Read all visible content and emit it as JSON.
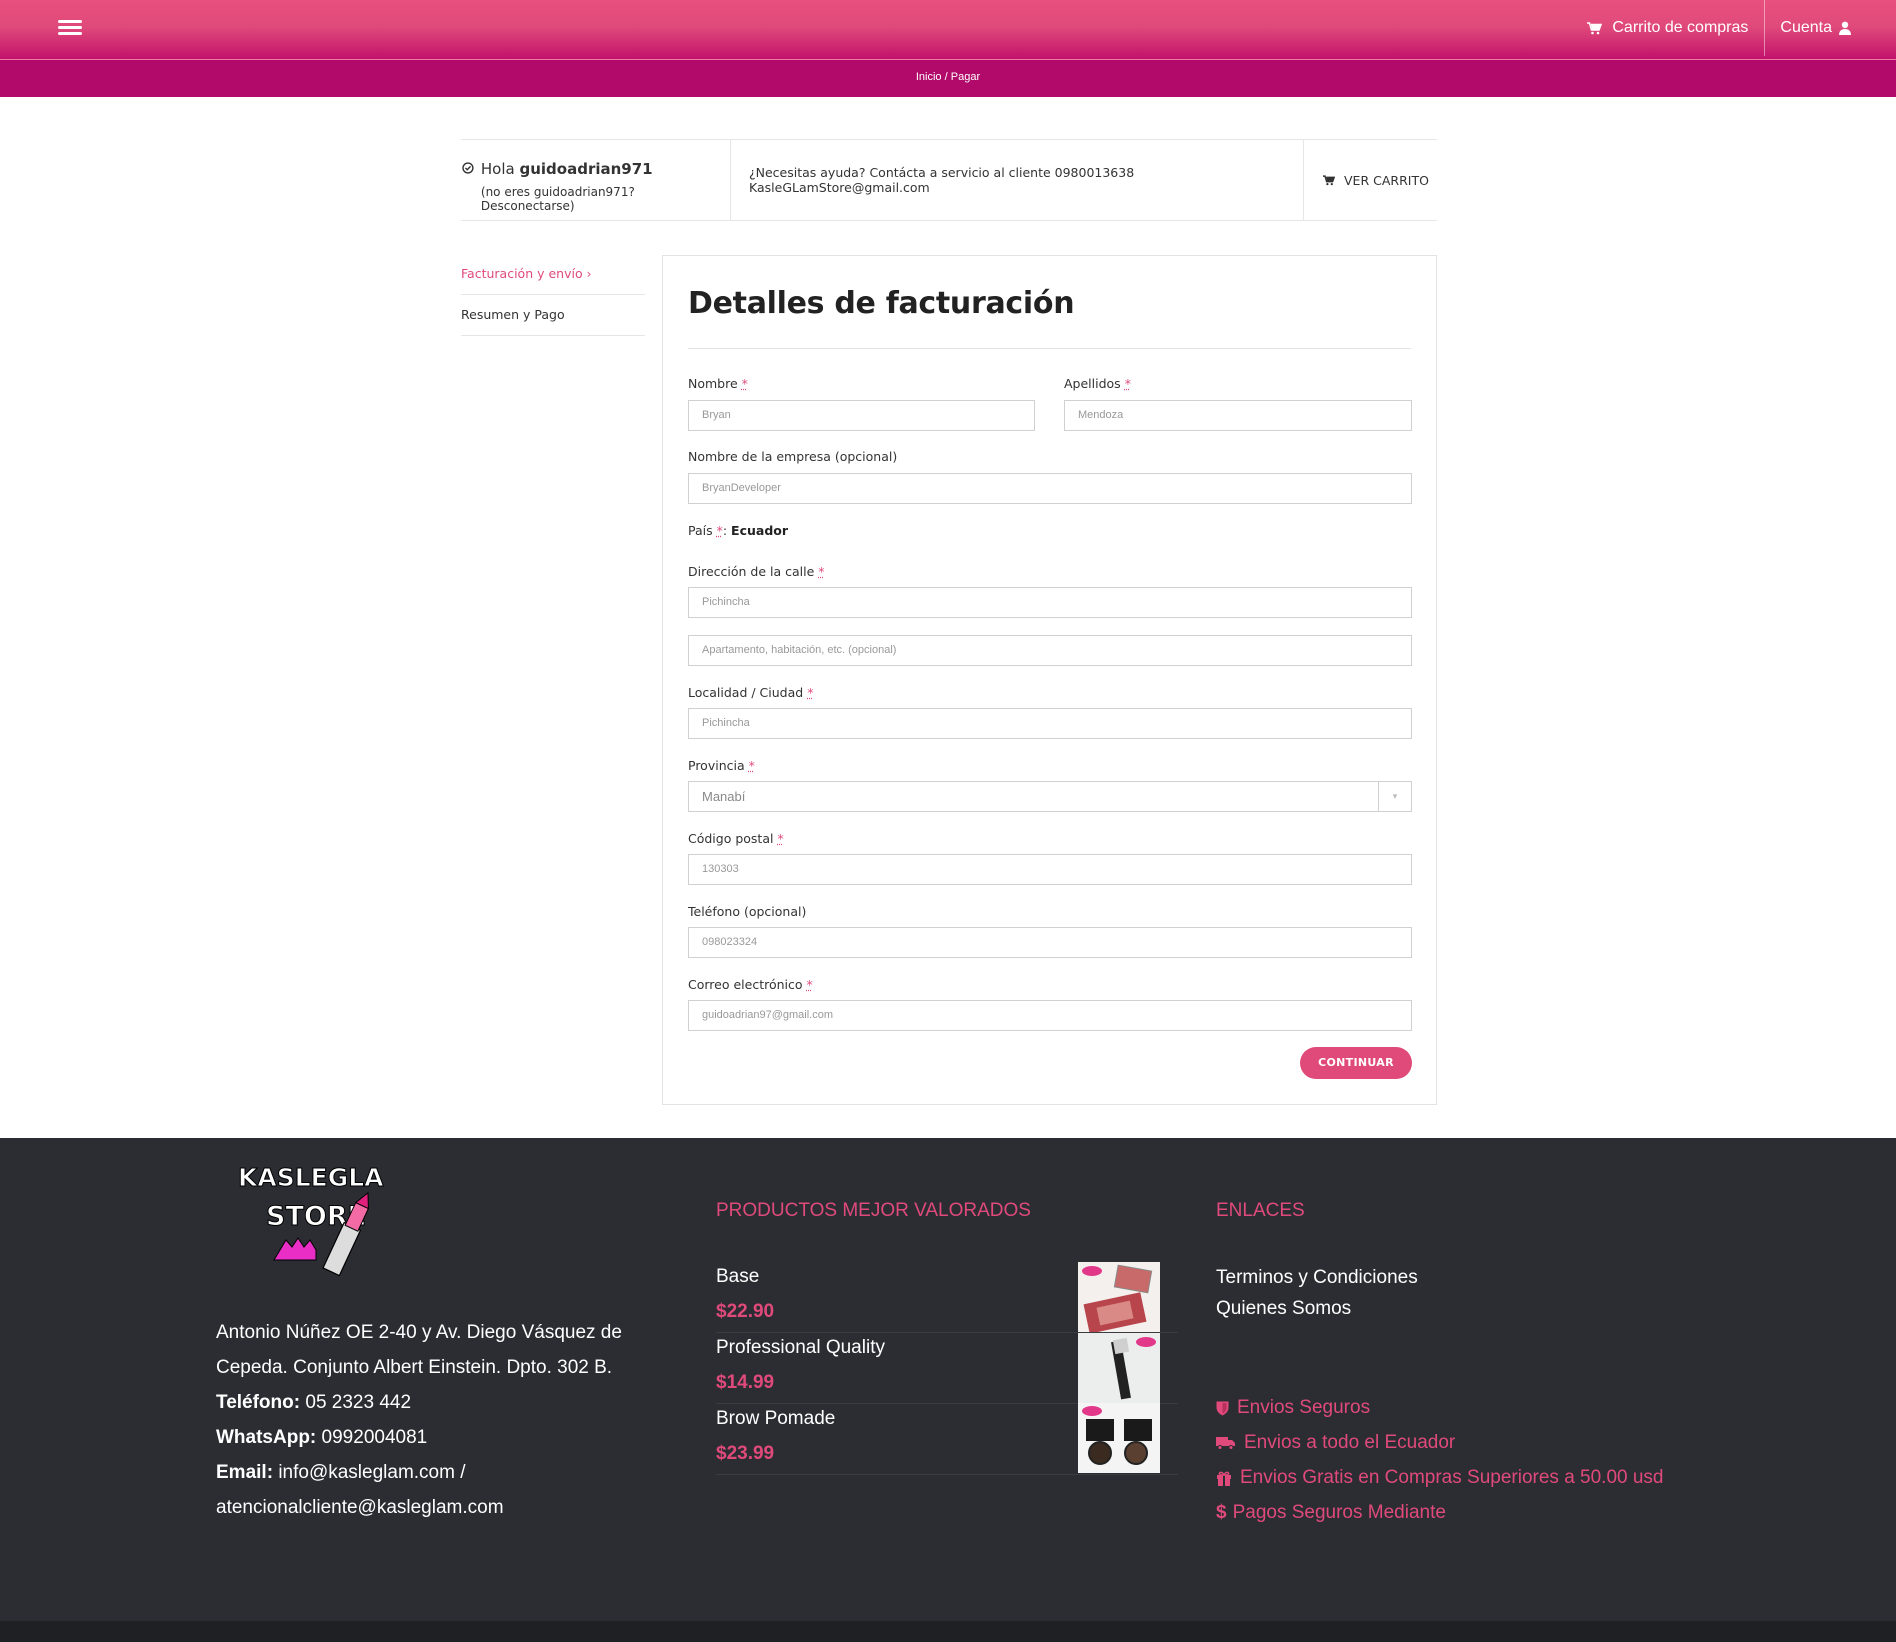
{
  "header": {
    "cart_label": "Carrito de compras",
    "account_label": "Cuenta"
  },
  "breadcrumb": {
    "home": "Inicio",
    "separator": "/",
    "current": "Pagar"
  },
  "info": {
    "hello_prefix": "Hola",
    "username": "guidoadrian971",
    "not_you_prefix": "(no eres guidoadrian971?",
    "logout": "Desconectarse)",
    "help_text": "¿Necesitas ayuda? Contácta a servicio al cliente 0980013638 KasleGLamStore@gmail.com",
    "view_cart": "VER CARRITO"
  },
  "steps": [
    {
      "label": "Facturación y envío ›",
      "active": true
    },
    {
      "label": "Resumen y Pago",
      "active": false
    }
  ],
  "form": {
    "title": "Detalles de facturación",
    "required_mark": "*",
    "first_name": {
      "label": "Nombre",
      "value": "Bryan"
    },
    "last_name": {
      "label": "Apellidos",
      "value": "Mendoza"
    },
    "company": {
      "label": "Nombre de la empresa (opcional)",
      "value": "BryanDeveloper"
    },
    "country": {
      "label": "País",
      "value": "Ecuador"
    },
    "street": {
      "label": "Dirección de la calle",
      "value": "Pichincha",
      "placeholder2": "Apartamento, habitación, etc. (opcional)"
    },
    "city": {
      "label": "Localidad / Ciudad",
      "value": "Pichincha"
    },
    "province": {
      "label": "Provincia",
      "value": "Manabí"
    },
    "postcode": {
      "label": "Código postal",
      "value": "130303"
    },
    "phone": {
      "label": "Teléfono (opcional)",
      "value": "098023324"
    },
    "email": {
      "label": "Correo electrónico",
      "value": "guidoadrian97@gmail.com"
    },
    "continue_label": "CONTINUAR"
  },
  "footer": {
    "logo_text_1": "KASLEGLAM",
    "logo_text_2": "STORE",
    "address": "Antonio Núñez OE 2-40 y Av. Diego Vásquez de Cepeda. Conjunto Albert Einstein. Dpto. 302 B.",
    "phone_label": "Teléfono:",
    "phone_value": "05 2323 442",
    "whatsapp_label": "WhatsApp:",
    "whatsapp_value": "0992004081",
    "email_label": "Email:",
    "email_value": "info@kasleglam.com /",
    "email_value_2": "atencionalcliente@kasleglam.com",
    "products_title": "PRODUCTOS MEJOR VALORADOS",
    "products": [
      {
        "name": "Base",
        "price": "$22.90"
      },
      {
        "name": "Professional Quality",
        "price": "$14.99"
      },
      {
        "name": "Brow Pomade",
        "price": "$23.99"
      }
    ],
    "links_title": "ENLACES",
    "links": [
      "Terminos y Condiciones",
      "Quienes Somos"
    ],
    "perks": [
      {
        "icon": "shield-icon",
        "text": "Envios Seguros"
      },
      {
        "icon": "truck-icon",
        "text": "Envios a todo el Ecuador"
      },
      {
        "icon": "gift-icon",
        "text": "Envios Gratis en Compras Superiores a 50.00 usd"
      },
      {
        "icon": "dollar-icon",
        "text": "Pagos Seguros Mediante"
      }
    ]
  },
  "colors": {
    "accent": "#e04a7a",
    "header_gradient_top": "#e8507e",
    "header_gradient_bottom": "#c2126c",
    "breadcrumb_bg": "#b20a6a",
    "footer_bg": "#2b2d33"
  }
}
